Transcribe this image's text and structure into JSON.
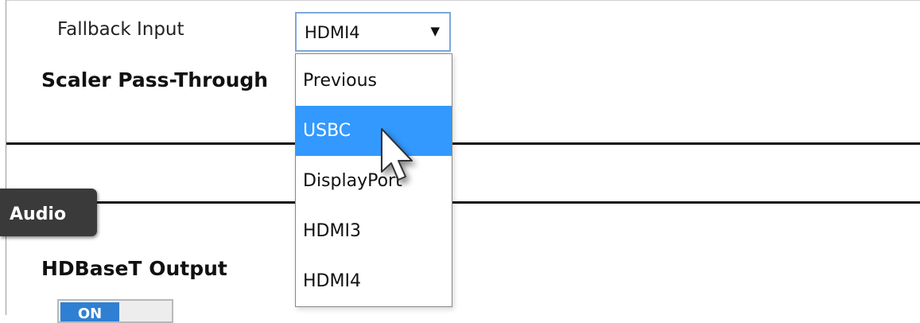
{
  "fallback": {
    "label": "Fallback Input",
    "selected_value": "HDMI4",
    "arrow_icon": "▼"
  },
  "scaler": {
    "label": "Scaler Pass-Through"
  },
  "audio_tab": {
    "label": "Audio"
  },
  "hdbaset": {
    "label": "HDBaseT Output",
    "toggle_label": "ON"
  },
  "dropdown": {
    "options": [
      "Previous",
      "USBC",
      "DisplayPort",
      "HDMI3",
      "HDMI4"
    ],
    "highlighted": "USBC",
    "highlight_color": "#3399ff"
  },
  "colors": {
    "audio_tab_bg": "#3a3a3a",
    "toggle_on": "#2f7fd3"
  }
}
